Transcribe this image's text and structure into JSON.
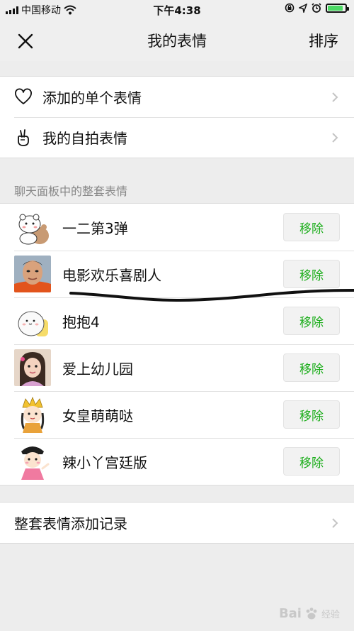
{
  "status_bar": {
    "carrier": "中国移动",
    "time": "下午4:38",
    "battery_level": 0.9
  },
  "nav": {
    "title": "我的表情",
    "sort_label": "排序"
  },
  "top_menu": [
    {
      "label": "添加的单个表情",
      "icon": "heart-outline-icon"
    },
    {
      "label": "我的自拍表情",
      "icon": "hand-gesture-icon"
    }
  ],
  "section_header": "聊天面板中的整套表情",
  "packs": [
    {
      "name": "一二第3弹",
      "remove_label": "移除",
      "thumb": "bear-cartoon"
    },
    {
      "name": "电影欢乐喜剧人",
      "remove_label": "移除",
      "thumb": "man-face-photo"
    },
    {
      "name": "抱抱4",
      "remove_label": "移除",
      "thumb": "white-blob-cartoon"
    },
    {
      "name": "爱上幼儿园",
      "remove_label": "移除",
      "thumb": "girl-photo"
    },
    {
      "name": "女皇萌萌哒",
      "remove_label": "移除",
      "thumb": "empress-cartoon"
    },
    {
      "name": "辣小丫宫廷版",
      "remove_label": "移除",
      "thumb": "palace-girl-cartoon"
    }
  ],
  "bottom_menu": {
    "label": "整套表情添加记录"
  },
  "watermark": {
    "brand": "Bai",
    "suffix": "经验"
  },
  "colors": {
    "accent_green": "#1aad19",
    "background": "#ededed",
    "battery_green": "#4cd964"
  }
}
